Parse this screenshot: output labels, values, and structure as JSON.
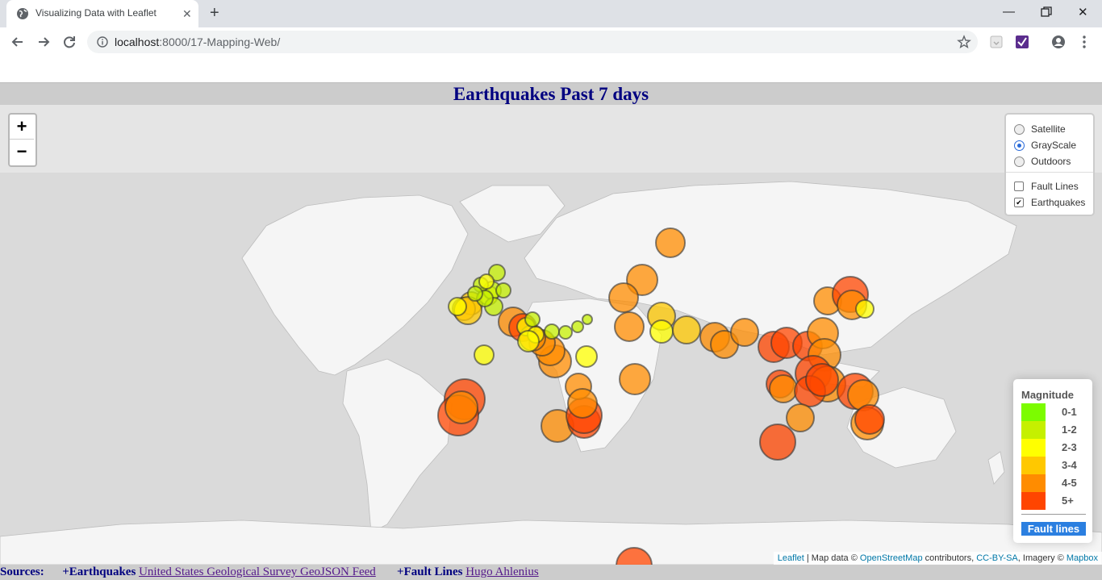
{
  "browser": {
    "tab_title": "Visualizing Data with Leaflet",
    "url_host": "localhost",
    "url_path": ":8000/17-Mapping-Web/"
  },
  "page": {
    "title": "Earthquakes Past 7 days"
  },
  "layers_control": {
    "base_layers": [
      {
        "label": "Satellite",
        "selected": false
      },
      {
        "label": "GrayScale",
        "selected": true
      },
      {
        "label": "Outdoors",
        "selected": false
      }
    ],
    "overlays": [
      {
        "label": "Fault Lines",
        "checked": false
      },
      {
        "label": "Earthquakes",
        "checked": true
      }
    ]
  },
  "zoom": {
    "in_label": "+",
    "out_label": "−"
  },
  "legend": {
    "title": "Magnitude",
    "items": [
      {
        "label": "0-1",
        "color": "#7cfc00"
      },
      {
        "label": "1-2",
        "color": "#c5f000"
      },
      {
        "label": "2-3",
        "color": "#ffff00"
      },
      {
        "label": "3-4",
        "color": "#ffc800"
      },
      {
        "label": "4-5",
        "color": "#ff8c00"
      },
      {
        "label": "5+",
        "color": "#ff4500"
      }
    ],
    "fault_lines_label": "Fault lines"
  },
  "attribution": {
    "leaflet": "Leaflet",
    "map_data": "| Map data ©",
    "osm": "OpenStreetMap",
    "contributors": "contributors,",
    "license": "CC-BY-SA",
    "imagery": ", Imagery ©",
    "mapbox": "Mapbox"
  },
  "footer": {
    "sources_label": "Sources:",
    "earthquakes_label": "+Earthquakes",
    "earthquakes_link": "United States Geological Survey GeoJSON Feed",
    "fault_label": "+Fault Lines",
    "fault_link": "Hugo Ahlenius"
  },
  "colors": {
    "title": "#000080",
    "map_background": "#dedede",
    "land": "#f6f6f6",
    "accent": "#2b7fe0"
  }
}
